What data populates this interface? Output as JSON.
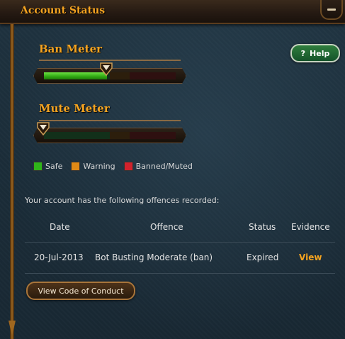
{
  "window": {
    "title": "Account Status",
    "minimize_icon": "minimize-icon"
  },
  "help": {
    "icon": "?",
    "label": "Help"
  },
  "ban_meter": {
    "title": "Ban Meter",
    "level": 0.48
  },
  "mute_meter": {
    "title": "Mute Meter",
    "level": 0.0
  },
  "legend": [
    {
      "label": "Safe",
      "color": "#2fb51a"
    },
    {
      "label": "Warning",
      "color": "#e08a16"
    },
    {
      "label": "Banned/Muted",
      "color": "#d1222c"
    }
  ],
  "offences": {
    "intro": "Your account has the following offences recorded:",
    "columns": [
      "Date",
      "Offence",
      "Status",
      "Evidence"
    ],
    "rows": [
      {
        "date": "20-Jul-2013",
        "offence": "Bot Busting Moderate (ban)",
        "status": "Expired",
        "evidence": "View"
      }
    ]
  },
  "conduct_button": "View Code of Conduct"
}
